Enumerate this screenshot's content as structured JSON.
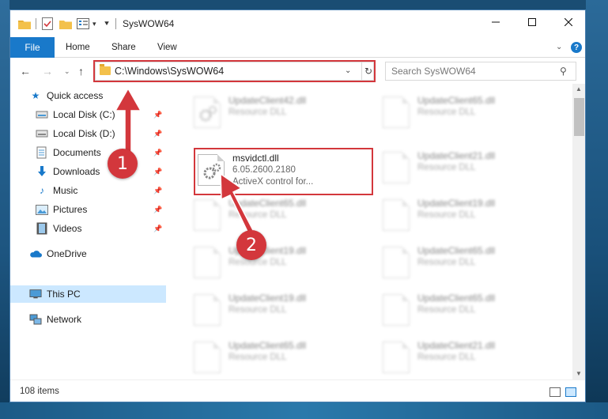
{
  "window": {
    "title": "SysWOW64"
  },
  "ribbon": {
    "tabs": [
      {
        "label": "File"
      },
      {
        "label": "Home"
      },
      {
        "label": "Share"
      },
      {
        "label": "View"
      }
    ]
  },
  "address": {
    "path": "C:\\Windows\\SysWOW64"
  },
  "search": {
    "placeholder": "Search SysWOW64"
  },
  "sidebar": {
    "items": [
      {
        "label": "Quick access",
        "icon": "star-icon",
        "pinned": false
      },
      {
        "label": "Local Disk (C:)",
        "icon": "drive-icon",
        "pinned": true
      },
      {
        "label": "Local Disk (D:)",
        "icon": "drive-icon",
        "pinned": true
      },
      {
        "label": "Documents",
        "icon": "documents-icon",
        "pinned": true
      },
      {
        "label": "Downloads",
        "icon": "downloads-icon",
        "pinned": true
      },
      {
        "label": "Music",
        "icon": "music-icon",
        "pinned": true
      },
      {
        "label": "Pictures",
        "icon": "pictures-icon",
        "pinned": true
      },
      {
        "label": "Videos",
        "icon": "videos-icon",
        "pinned": true
      },
      {
        "label": "OneDrive",
        "icon": "cloud-icon",
        "pinned": false
      },
      {
        "label": "This PC",
        "icon": "computer-icon",
        "pinned": false,
        "selected": true
      },
      {
        "label": "Network",
        "icon": "network-icon",
        "pinned": false
      }
    ]
  },
  "files": {
    "left": [
      {
        "name": "UpdateClient42.dll",
        "type": "Resource DLL"
      },
      {
        "name": "msvidctl.dll",
        "version": "6.05.2600.2180",
        "description": "ActiveX control for..."
      },
      {
        "name": "UpdateClient65.dll",
        "type": "Resource DLL"
      },
      {
        "name": "UpdateClient19.dll",
        "type": "Resource DLL"
      },
      {
        "name": "UpdateClient19.dll",
        "type": "Resource DLL"
      },
      {
        "name": "UpdateClient65.dll",
        "type": "Resource DLL"
      }
    ],
    "right": [
      {
        "name": "UpdateClient65.dll",
        "type": "Resource DLL"
      },
      {
        "name": "UpdateClient21.dll",
        "type": "Resource DLL"
      },
      {
        "name": "UpdateClient19.dll",
        "type": "Resource DLL"
      },
      {
        "name": "UpdateClient65.dll",
        "type": "Resource DLL"
      },
      {
        "name": "UpdateClient65.dll",
        "type": "Resource DLL"
      },
      {
        "name": "UpdateClient21.dll",
        "type": "Resource DLL"
      }
    ]
  },
  "status": {
    "item_count": "108 items"
  },
  "annotations": {
    "step1": "1",
    "step2": "2",
    "highlight_color": "#d3373c"
  },
  "colors": {
    "accent": "#1979ca",
    "selection": "#cce8ff"
  }
}
